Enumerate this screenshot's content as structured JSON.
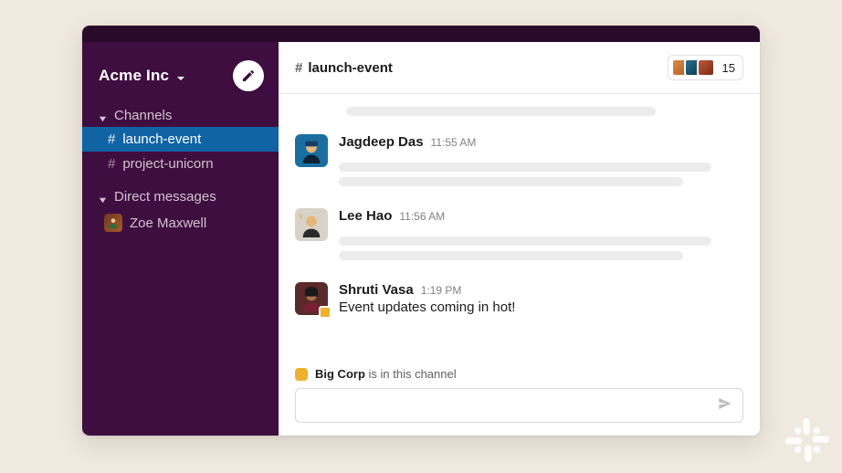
{
  "workspace": {
    "name": "Acme Inc"
  },
  "sidebar": {
    "sections": {
      "channels_label": "Channels",
      "dms_label": "Direct messages"
    },
    "channels": [
      {
        "name": "launch-event",
        "active": true
      },
      {
        "name": "project-unicorn",
        "active": false
      }
    ],
    "dms": [
      {
        "name": "Zoe Maxwell"
      }
    ]
  },
  "channel": {
    "name": "launch-event",
    "member_count": "15"
  },
  "messages": [
    {
      "author": "Jagdeep Das",
      "time": "11:55 AM",
      "text": null
    },
    {
      "author": "Lee Hao",
      "time": "11:56 AM",
      "text": null
    },
    {
      "author": "Shruti Vasa",
      "time": "1:19 PM",
      "text": "Event updates coming in hot!"
    }
  ],
  "context_note": {
    "app_name": "Big Corp",
    "suffix": " is in this channel"
  }
}
